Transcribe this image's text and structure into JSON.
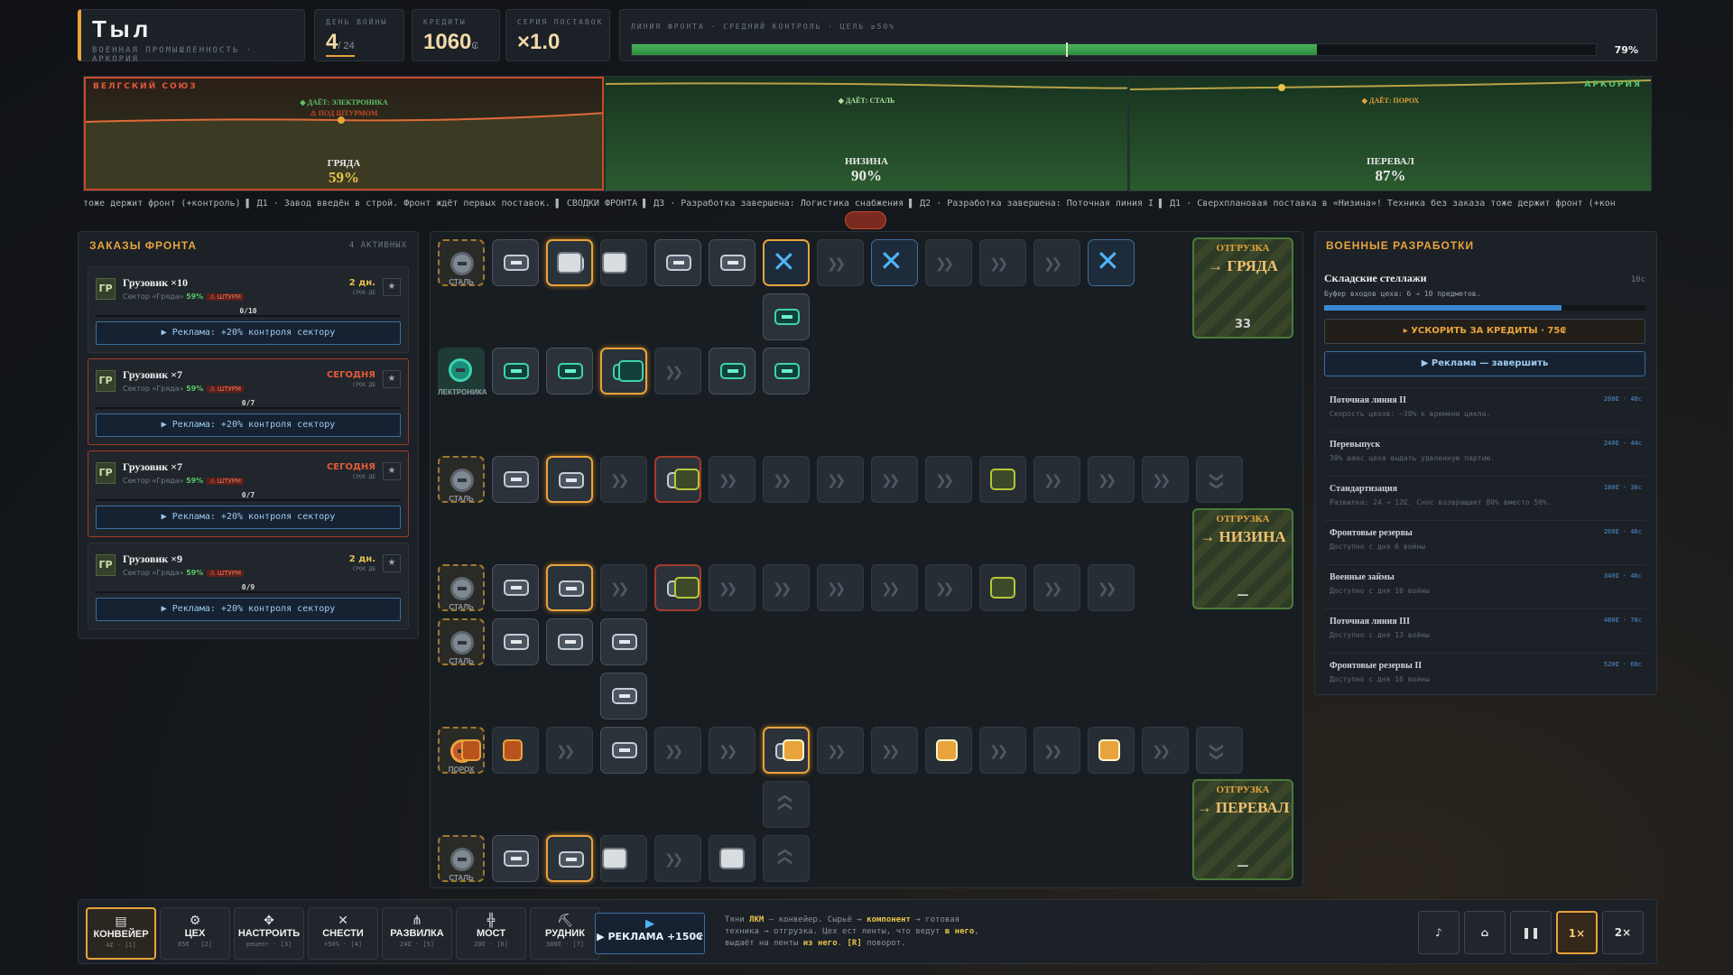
{
  "header": {
    "title": "Тыл",
    "subtitle": "ВОЕННАЯ ПРОМЫШЛЕННОСТЬ · АРКОРИЯ",
    "day_label": "ДЕНЬ ВОЙНЫ",
    "day": "4",
    "day_total": "/ 24",
    "credits_label": "КРЕДИТЫ",
    "credits": "1060",
    "credits_unit": "₢",
    "streak_label": "СЕРИЯ ПОСТАВОК",
    "streak": "×1.0",
    "front_label": "ЛИНИЯ ФРОНТА · СРЕДНИЙ КОНТРОЛЬ · ЦЕЛЬ ≥50%",
    "front_pct_text": "79%",
    "front_value": 0.79,
    "front_goal": 0.5
  },
  "map": {
    "left_side": "ВЕЛГСКИЙ СОЮЗ",
    "right_side": "АРКОРИЯ",
    "sectors": [
      {
        "name": "ГРЯДА",
        "pct": "59%",
        "gives": "◆ ДАЁТ: ЭЛЕКТРОНИКА",
        "alert": "⚠ ПОД ШТУРМОМ",
        "control": 0.59
      },
      {
        "name": "НИЗИНА",
        "pct": "90%",
        "gives": "◆ ДАЁТ: СТАЛЬ",
        "control": 0.9
      },
      {
        "name": "ПЕРЕВАЛ",
        "pct": "87%",
        "gives": "◆ ДАЁТ: ПОРОХ",
        "control": 0.87
      }
    ]
  },
  "ticker": "тоже держит фронт (+контроль) ▌ Д1 · Завод введён в строй. Фронт ждёт первых поставок. ▌ СВОДКИ ФРОНТА ▌ Д3 · Разработка завершена: Логистика снабжения ▌ Д2 · Разработка завершена: Поточная линия I ▌ Д1 · Сверхплановая поставка в «Низина»! Техника без заказа тоже держит фронт (+кон",
  "orders": {
    "title": "ЗАКАЗЫ ФРОНТА",
    "active": "4 АКТИВНЫХ",
    "items": [
      {
        "icon": "ГР",
        "name": "Грузовик ×10",
        "sector": "Сектор «Гряда»",
        "pct": "59%",
        "storm": "⚠ ШТУРМ",
        "deadline": "2 дн.",
        "deadline_sub": "СРОК ДБ",
        "count": "0/10",
        "ad": "▶ Реклама: +20% контроля сектору",
        "urgent": false
      },
      {
        "icon": "ГР",
        "name": "Грузовик ×7",
        "sector": "Сектор «Гряда»",
        "pct": "59%",
        "storm": "⚠ ШТУРМ",
        "deadline": "СЕГОДНЯ",
        "deadline_sub": "СРОК ДБ",
        "count": "0/7",
        "ad": "▶ Реклама: +20% контроля сектору",
        "urgent": true
      },
      {
        "icon": "ГР",
        "name": "Грузовик ×7",
        "sector": "Сектор «Гряда»",
        "pct": "59%",
        "storm": "⚠ ШТУРМ",
        "deadline": "СЕГОДНЯ",
        "deadline_sub": "СРОК ДБ",
        "count": "0/7",
        "ad": "▶ Реклама: +20% контроля сектору",
        "urgent": true
      },
      {
        "icon": "ГР",
        "name": "Грузовик ×9",
        "sector": "Сектор «Гряда»",
        "pct": "59%",
        "storm": "⚠ ШТУРМ",
        "deadline": "2 дн.",
        "deadline_sub": "СРОК ДБ",
        "count": "0/9",
        "ad": "▶ Реклама: +20% контроля сектору",
        "urgent": false
      }
    ]
  },
  "factory": {
    "resources": {
      "steel": "СТАЛЬ",
      "electronics": "ЛЕКТРОНИКА",
      "powder": "ПОРОХ"
    },
    "shipments": [
      {
        "label": "ОТГРУЗКА",
        "dest": "→ ГРЯДА",
        "qty": "33"
      },
      {
        "label": "ОТГРУЗКА",
        "dest": "→ НИЗИНА",
        "qty": "—"
      },
      {
        "label": "ОТГРУЗКА",
        "dest": "→ ПЕРЕВАЛ",
        "qty": "—"
      }
    ]
  },
  "research": {
    "title": "ВОЕННЫЕ РАЗРАБОТКИ",
    "current": {
      "name": "Складские стеллажи",
      "time": "10с",
      "desc": "Буфер входов цеха: 6 → 10 предметов.",
      "progress": 0.74
    },
    "speedup": "▸ УСКОРИТЬ ЗА КРЕДИТЫ · 75₢",
    "ad": "▶ Реклама — завершить",
    "items": [
      {
        "name": "Поточная линия II",
        "cost": "260₢ · 48с",
        "desc": "Скорость цехов: −30% к времени цикла."
      },
      {
        "name": "Перевыпуск",
        "cost": "240₢ · 44с",
        "desc": "30% шанс цеха выдать удвоенную партию."
      },
      {
        "name": "Стандартизация",
        "cost": "180₢ · 30с",
        "desc": "Развилка: 24 → 12₢. Снос возвращает 80% вместо 50%."
      },
      {
        "name": "Фронтовые резервы",
        "cost": "260₢ · 46с",
        "desc": "Доступно с дня 6 войны"
      },
      {
        "name": "Военные займы",
        "cost": "340₢ · 46с",
        "desc": "Доступно с дня 10 войны"
      },
      {
        "name": "Поточная линия III",
        "cost": "480₢ · 70с",
        "desc": "Доступно с дня 13 войны"
      },
      {
        "name": "Фронтовые резервы II",
        "cost": "520₢ · 60с",
        "desc": "Доступно с дня 16 войны"
      }
    ]
  },
  "toolbar": {
    "tools": [
      {
        "icon": "▤",
        "name": "КОНВЕЙЕР",
        "cost": "4₢ · [1]"
      },
      {
        "icon": "⚙",
        "name": "ЦЕХ",
        "cost": "85₢ · [2]"
      },
      {
        "icon": "✥",
        "name": "НАСТРОИТЬ",
        "cost": "рецепт · [3]"
      },
      {
        "icon": "✕",
        "name": "СНЕСТИ",
        "cost": "+50% · [4]"
      },
      {
        "icon": "⋔",
        "name": "РАЗВИЛКА",
        "cost": "24₢ · [5]"
      },
      {
        "icon": "╬",
        "name": "МОСТ",
        "cost": "20₢ · [6]"
      },
      {
        "icon": "⛏",
        "name": "РУДНИК",
        "cost": "380₢ · [7]"
      }
    ],
    "ad": "▶ РЕКЛАМА +150₢",
    "help_1": "Тяни ",
    "help_lkm": "ЛКМ",
    "help_2": " — конвейер. Сырьё → ",
    "help_comp": "компонент",
    "help_3": " → готовая техника → отгрузка. Цех ест ленты, что ведут ",
    "help_in": "в него",
    "help_4": ", выдаёт на ленты ",
    "help_out": "из него",
    "help_5": ". ",
    "help_r": "[R]",
    "help_6": " поворот.",
    "controls": [
      "♪",
      "⌂",
      "❚❚",
      "1×",
      "2×"
    ]
  },
  "colors": {
    "accent": "#e8a33c",
    "front": "#49b35a",
    "danger": "#a23a2a",
    "info": "#3a88d4",
    "teal": "#3ed2b0"
  }
}
